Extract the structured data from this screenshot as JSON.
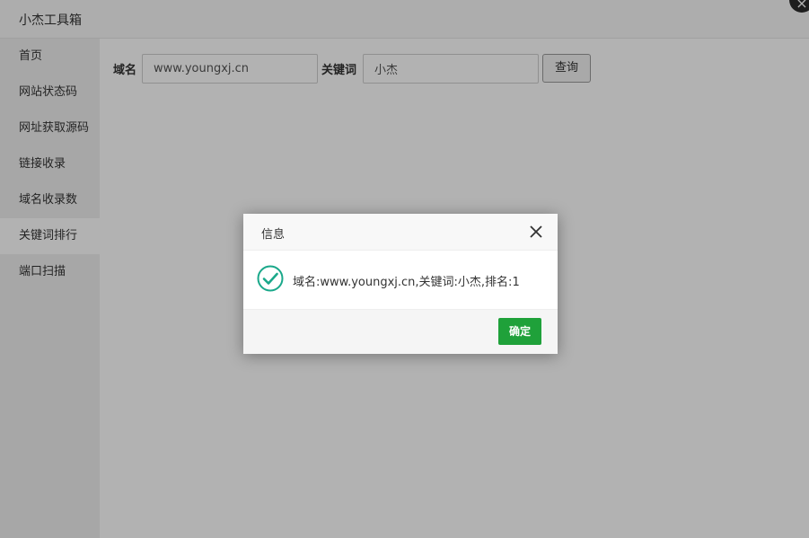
{
  "window": {
    "title": "小杰工具箱",
    "close_icon": "close-icon"
  },
  "sidebar": {
    "items": [
      {
        "label": "首页",
        "active": false
      },
      {
        "label": "网站状态码",
        "active": false
      },
      {
        "label": "网址获取源码",
        "active": false
      },
      {
        "label": "链接收录",
        "active": false
      },
      {
        "label": "域名收录数",
        "active": false
      },
      {
        "label": "关键词排行",
        "active": true
      },
      {
        "label": "端口扫描",
        "active": false
      }
    ]
  },
  "form": {
    "domain_label": "域名",
    "domain_value": "www.youngxj.cn",
    "keyword_label": "关键词",
    "keyword_value": "小杰",
    "query_button": "查询"
  },
  "dialog": {
    "title": "信息",
    "close_icon": "close-icon",
    "status_icon": "check-circle-icon",
    "message": "域名:www.youngxj.cn,关键词:小杰,排名:1",
    "confirm_button": "确定"
  },
  "colors": {
    "accent_green": "#1fa13a",
    "overlay": "rgba(0,0,0,0.30)",
    "sidebar_bg": "#f0f0f0"
  }
}
